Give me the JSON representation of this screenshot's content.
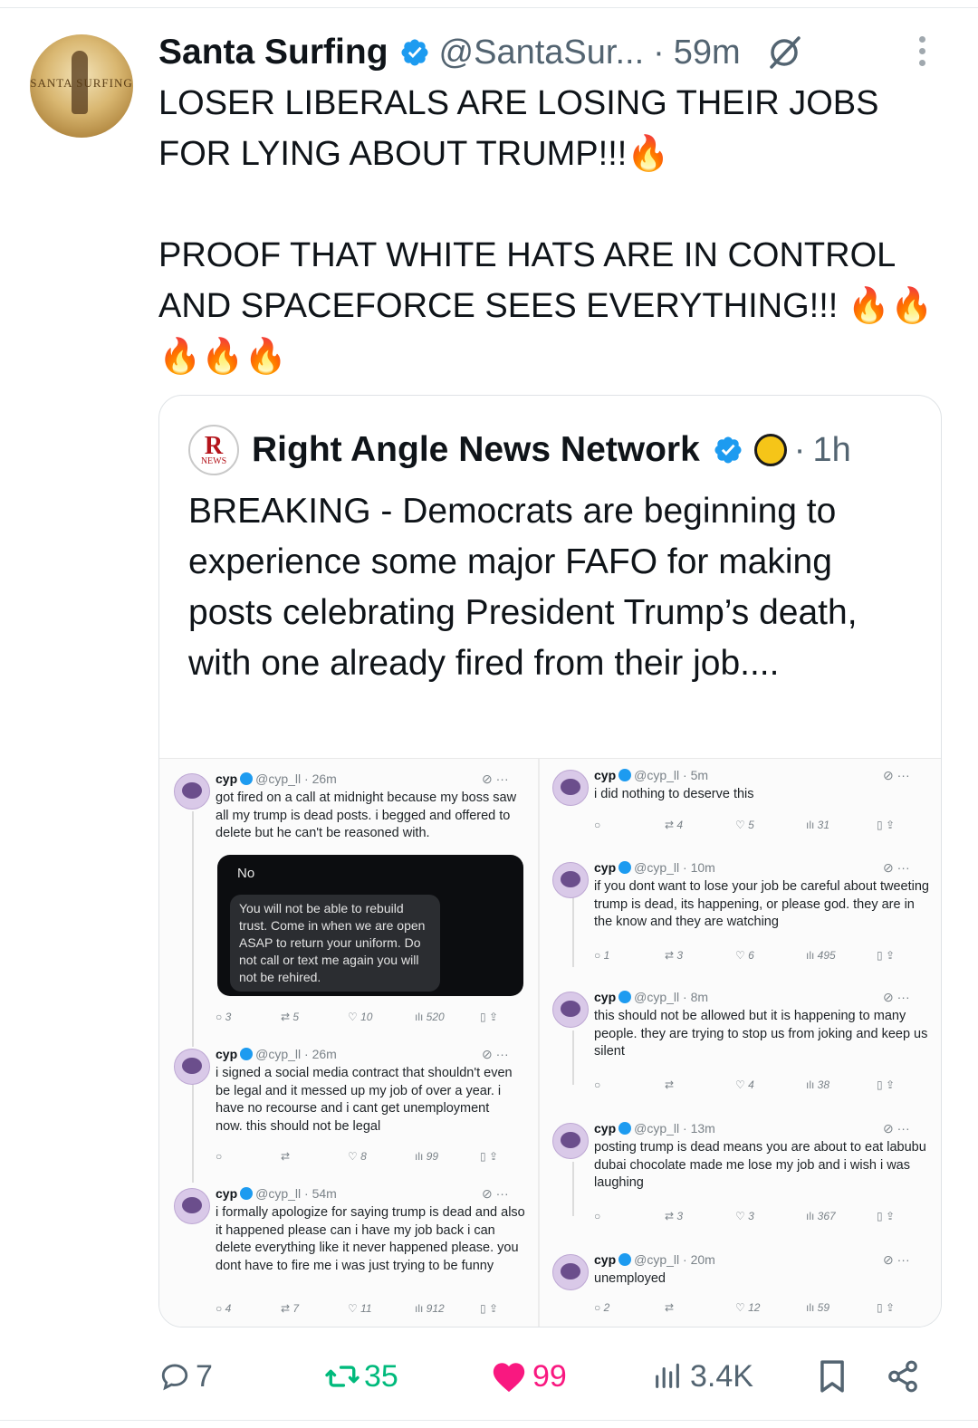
{
  "tweet": {
    "author_name": "Santa Surfing",
    "author_handle": "@SantaSur...",
    "time": "59m",
    "separator": "·",
    "avatar_logo_text": "SANTA SURFING",
    "text": "LOSER LIBERALS ARE LOSING THEIR JOBS FOR LYING ABOUT TRUMP!!!🔥\n\nPROOF THAT WHITE HATS ARE IN CONTROL AND SPACEFORCE SEES EVERYTHING!!! 🔥🔥🔥🔥🔥"
  },
  "quote": {
    "author_name": "Right Angle News Network",
    "logo_letter": "R",
    "logo_word": "NEWS",
    "time": "1h",
    "separator": "·",
    "text": "BREAKING - Democrats are beginning to experience some major FAFO for making posts celebrating President Trump’s death, with one already fired from their job...."
  },
  "screenshot_posts": {
    "left": [
      {
        "name": "cyp",
        "handle": "@cyp_ll · 26m",
        "body": "got fired on a call at midnight because my boss saw all my trump is dead posts. i begged and offered to delete but he can't be reasoned with.",
        "image_header": "No",
        "image_message": "You will not be able to rebuild trust. Come in when we are open ASAP to return your uniform. Do not call or text me again you will not be rehired.",
        "replies": "3",
        "reposts": "5",
        "likes": "10",
        "views": "520"
      },
      {
        "name": "cyp",
        "handle": "@cyp_ll · 26m",
        "body": "i signed a social media contract that shouldn't even be legal and it messed up my job of over a year. i have no recourse and i cant get unemployment now. this should not be legal",
        "replies": "",
        "reposts": "",
        "likes": "8",
        "views": "99"
      },
      {
        "name": "cyp",
        "handle": "@cyp_ll · 54m",
        "body": "i formally apologize for saying trump is dead and also it happened please can i have my job back i can delete everything like it never happened please. you dont have to fire me i was just trying to be funny",
        "replies": "4",
        "reposts": "7",
        "likes": "11",
        "views": "912"
      }
    ],
    "right": [
      {
        "name": "cyp",
        "handle": "@cyp_ll · 5m",
        "body": "i did nothing to deserve this",
        "replies": "",
        "reposts": "4",
        "likes": "5",
        "views": "31"
      },
      {
        "name": "cyp",
        "handle": "@cyp_ll · 10m",
        "body": "if you dont want to lose your job be careful about tweeting trump is dead, its happening, or please god. they are in the know and they are watching",
        "replies": "1",
        "reposts": "3",
        "likes": "6",
        "views": "495"
      },
      {
        "name": "cyp",
        "handle": "@cyp_ll · 8m",
        "body": "this should not be allowed but it is happening to many people. they are trying to stop us from joking and keep us silent",
        "replies": "",
        "reposts": "",
        "likes": "4",
        "views": "38"
      },
      {
        "name": "cyp",
        "handle": "@cyp_ll · 13m",
        "body": "posting trump is dead means you are about to eat labubu dubai chocolate made me lose my job and i wish i was laughing",
        "replies": "",
        "reposts": "3",
        "likes": "3",
        "views": "367"
      },
      {
        "name": "cyp",
        "handle": "@cyp_ll · 20m",
        "body": "unemployed",
        "replies": "2",
        "reposts": "",
        "likes": "12",
        "views": "59"
      }
    ]
  },
  "actions": {
    "replies": "7",
    "reposts": "35",
    "likes": "99",
    "views": "3.4K"
  },
  "colors": {
    "verified": "#1d9bf0",
    "repost_active": "#00ba7c",
    "like_active": "#f91880",
    "muted": "#536471"
  },
  "icons": [
    "verified-badge-icon",
    "grok-icon",
    "more-icon",
    "reply-icon",
    "repost-icon",
    "like-icon",
    "views-icon",
    "bookmark-icon",
    "share-icon"
  ]
}
